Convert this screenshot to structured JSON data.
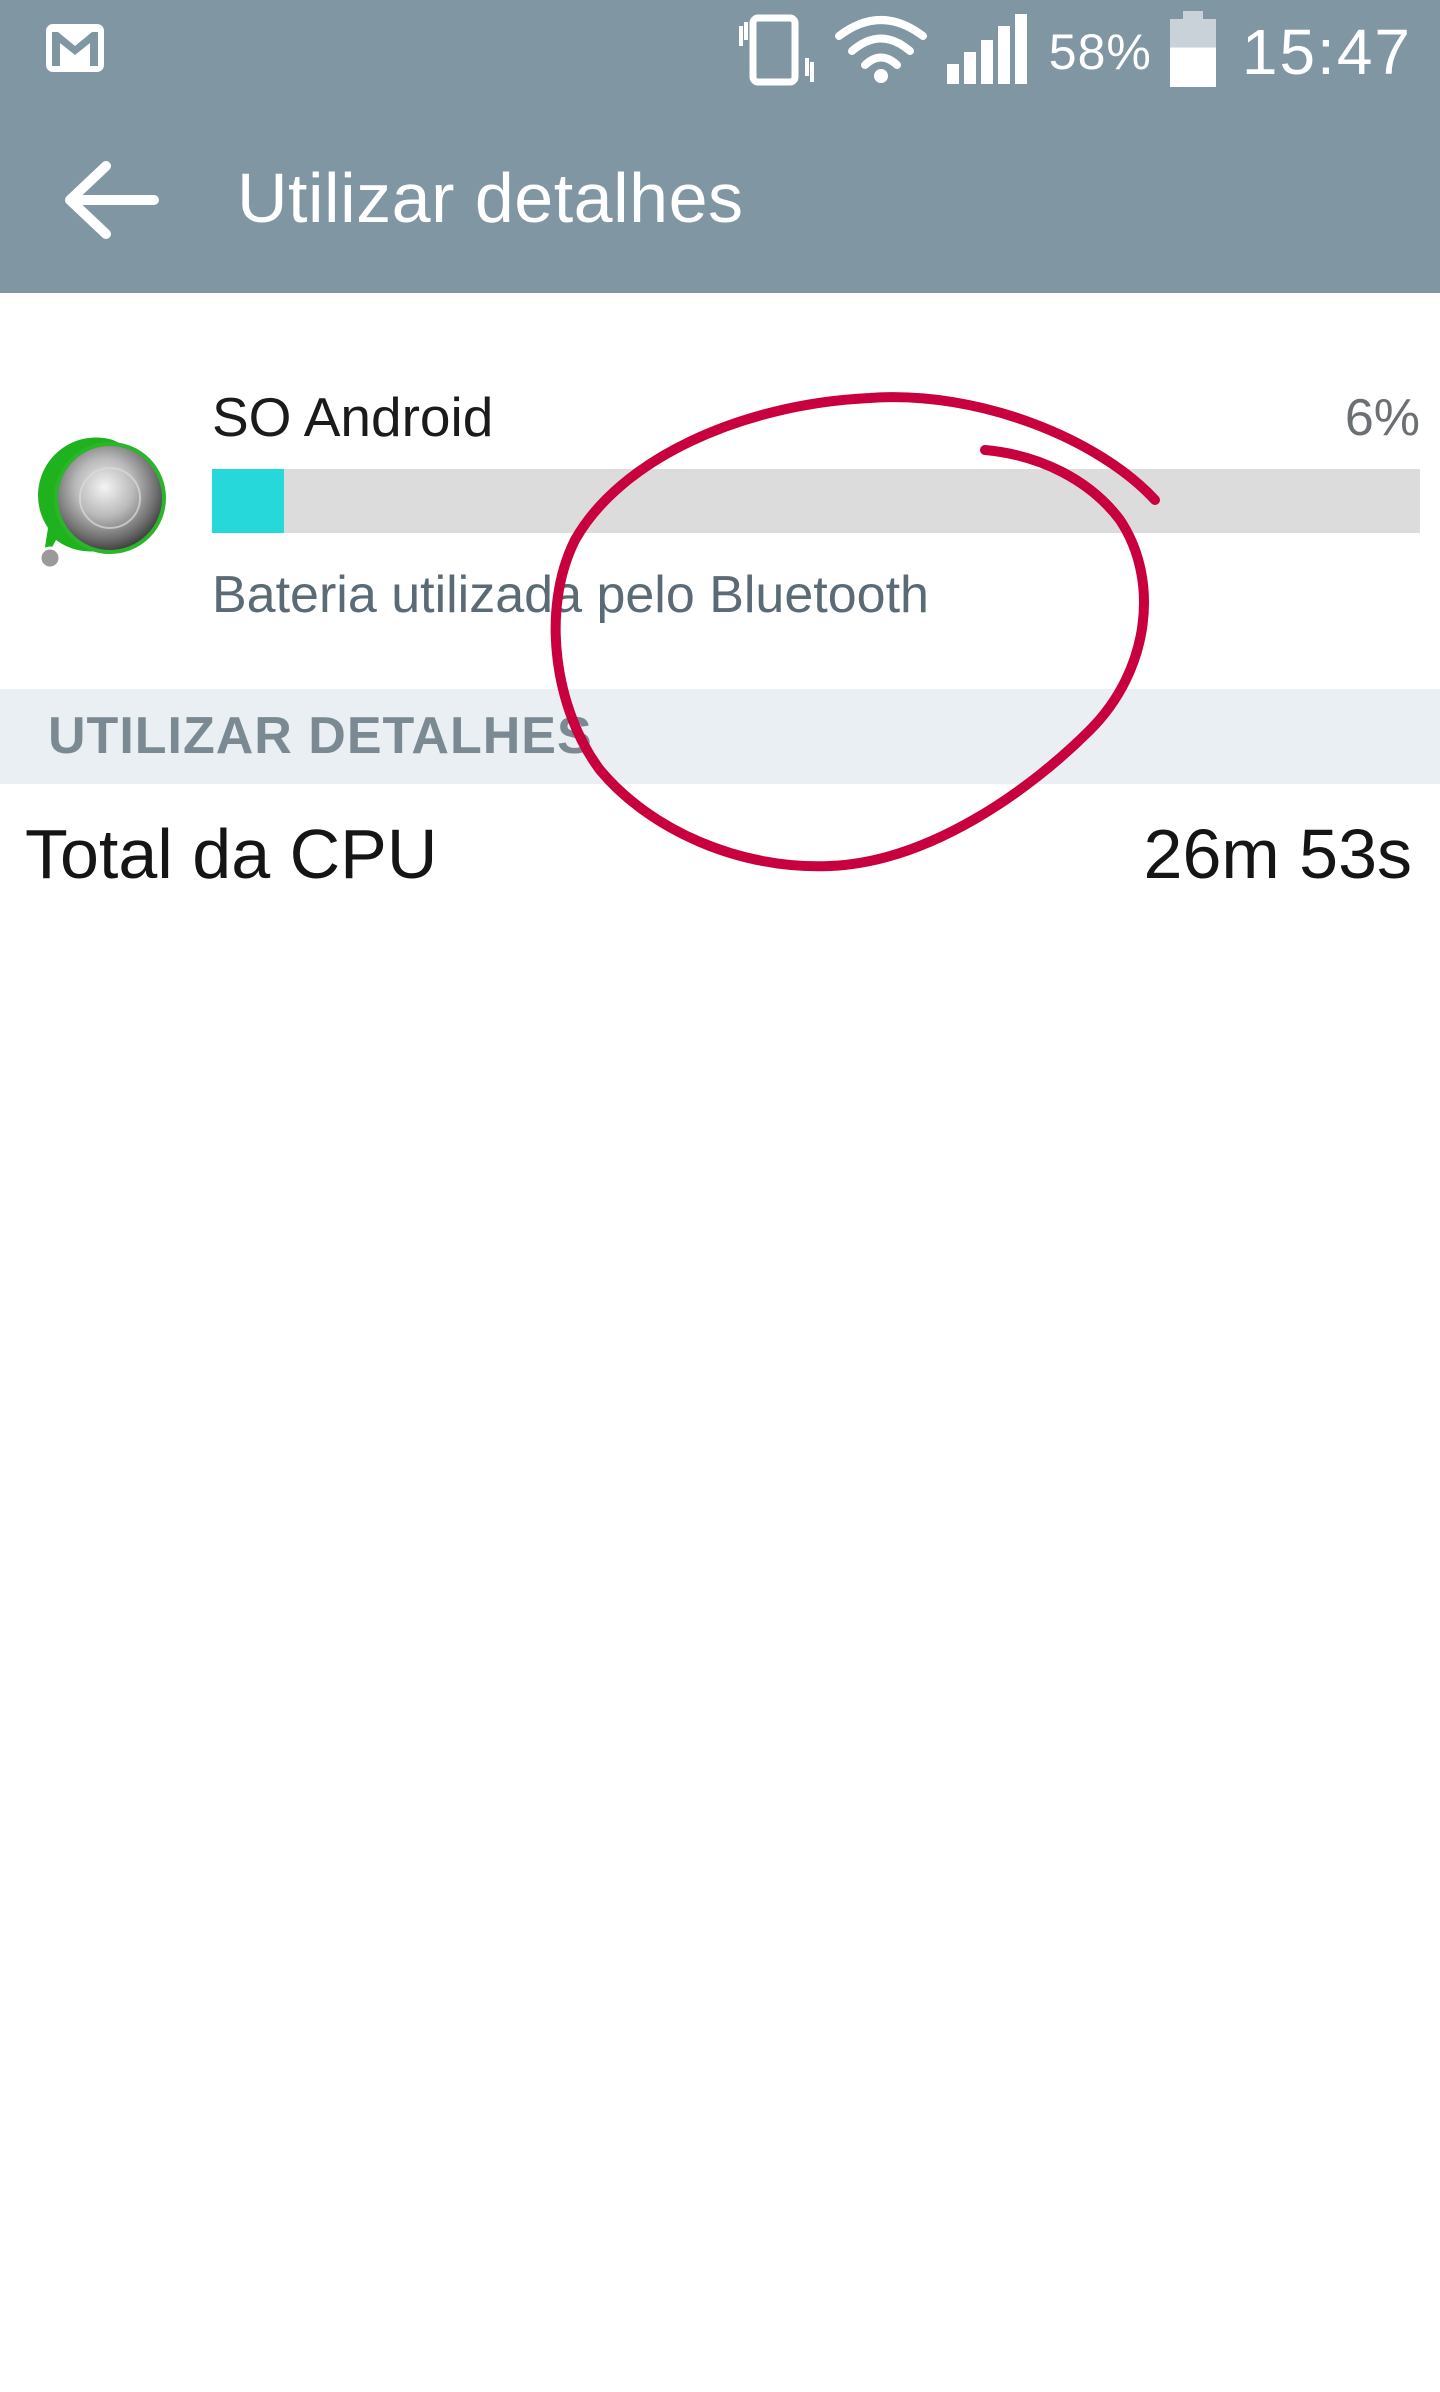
{
  "status_bar": {
    "notification_icon": "gmail-icon",
    "vibrate_icon": "vibrate-icon",
    "wifi_icon": "wifi-icon",
    "signal_icon": "signal-icon",
    "battery_icon": "battery-icon",
    "battery_percent": "58%",
    "battery_level": 0.58,
    "time": "15:47"
  },
  "toolbar": {
    "back_icon": "arrow-left-icon",
    "title": "Utilizar detalhes"
  },
  "app_usage": {
    "icon": "android-os-icon",
    "name": "SO Android",
    "percent": "6%",
    "usage_fraction": 0.06,
    "description": "Bateria utilizada pelo Bluetooth"
  },
  "section": {
    "header": "UTILIZAR DETALHES"
  },
  "details": [
    {
      "label": "Total da CPU",
      "value": "26m 53s"
    }
  ],
  "colors": {
    "header_bg": "#8096a3",
    "bar_fill": "#27d8db",
    "bar_track": "#dcdcdc",
    "section_bg": "#e9eff2",
    "annotation": "#c8003e"
  }
}
